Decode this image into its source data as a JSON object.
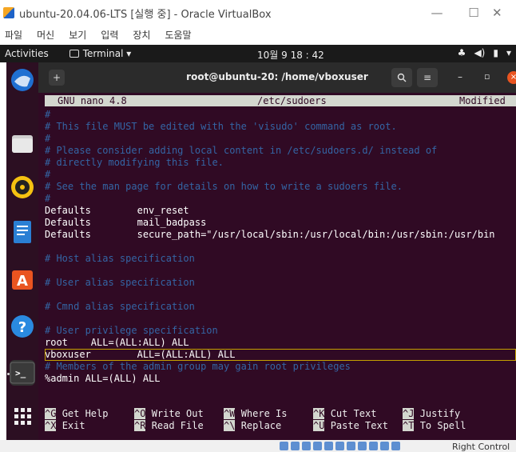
{
  "window": {
    "title": "ubuntu-20.04.06-LTS [실행 중] - Oracle VirtualBox",
    "minimize": "—",
    "maximize": "☐",
    "close": "✕"
  },
  "vbox_menu": [
    "파일",
    "머신",
    "보기",
    "입력",
    "장치",
    "도움말"
  ],
  "gnome": {
    "activities": "Activities",
    "app": "Terminal ▾",
    "clock": "10월 9  18 : 42",
    "tray": [
      "♣",
      "◀)",
      "▮",
      "▾"
    ]
  },
  "dock": [
    {
      "name": "thunderbird",
      "color": "#1f6fd1"
    },
    {
      "name": "files",
      "color": "#cfcfcf"
    },
    {
      "name": "rhythmbox",
      "color": "#f5c211"
    },
    {
      "name": "writer",
      "color": "#2a7fd4"
    },
    {
      "name": "software",
      "color": "#e95420"
    },
    {
      "name": "help",
      "color": "#2a8ae0"
    },
    {
      "name": "terminal",
      "color": "#333333"
    },
    {
      "name": "show-apps",
      "color": "#2c0f22"
    }
  ],
  "terminal": {
    "title": "root@ubuntu-20: /home/vboxuser",
    "new_tab": "+",
    "search": "🔍",
    "menu": "≡",
    "minimize": "–",
    "maximize": "▫",
    "close": "×"
  },
  "nano": {
    "version": "GNU nano 4.8",
    "file": "/etc/sudoers",
    "state": "Modified",
    "lines": [
      {
        "text": "#",
        "kind": "comment"
      },
      {
        "text": "# This file MUST be edited with the 'visudo' command as root.",
        "kind": "comment"
      },
      {
        "text": "#",
        "kind": "comment"
      },
      {
        "text": "# Please consider adding local content in /etc/sudoers.d/ instead of",
        "kind": "comment"
      },
      {
        "text": "# directly modifying this file.",
        "kind": "comment"
      },
      {
        "text": "#",
        "kind": "comment"
      },
      {
        "text": "# See the man page for details on how to write a sudoers file.",
        "kind": "comment"
      },
      {
        "text": "#",
        "kind": "comment"
      },
      {
        "text": "Defaults        env_reset",
        "kind": "normal"
      },
      {
        "text": "Defaults        mail_badpass",
        "kind": "normal"
      },
      {
        "text": "Defaults        secure_path=\"/usr/local/sbin:/usr/local/bin:/usr/sbin:/usr/bin",
        "kind": "normal"
      },
      {
        "text": "",
        "kind": "normal"
      },
      {
        "text": "# Host alias specification",
        "kind": "comment"
      },
      {
        "text": "",
        "kind": "normal"
      },
      {
        "text": "# User alias specification",
        "kind": "comment"
      },
      {
        "text": "",
        "kind": "normal"
      },
      {
        "text": "# Cmnd alias specification",
        "kind": "comment"
      },
      {
        "text": "",
        "kind": "normal"
      },
      {
        "text": "# User privilege specification",
        "kind": "comment"
      },
      {
        "text": "root    ALL=(ALL:ALL) ALL",
        "kind": "normal"
      },
      {
        "text": "vboxuser        ALL=(ALL:ALL) ALL",
        "kind": "highlight"
      },
      {
        "text": "# Members of the admin group may gain root privileges",
        "kind": "comment"
      },
      {
        "text": "%admin ALL=(ALL) ALL",
        "kind": "normal"
      }
    ],
    "shortcuts": [
      {
        "key": "^G",
        "label": "Get Help"
      },
      {
        "key": "^O",
        "label": "Write Out"
      },
      {
        "key": "^W",
        "label": "Where Is"
      },
      {
        "key": "^K",
        "label": "Cut Text"
      },
      {
        "key": "^J",
        "label": "Justify"
      },
      {
        "key": "^X",
        "label": "Exit"
      },
      {
        "key": "^R",
        "label": "Read File"
      },
      {
        "key": "^\\",
        "label": "Replace"
      },
      {
        "key": "^U",
        "label": "Paste Text"
      },
      {
        "key": "^T",
        "label": "To Spell"
      }
    ]
  },
  "statusbar": {
    "host_key": "Right Control"
  }
}
